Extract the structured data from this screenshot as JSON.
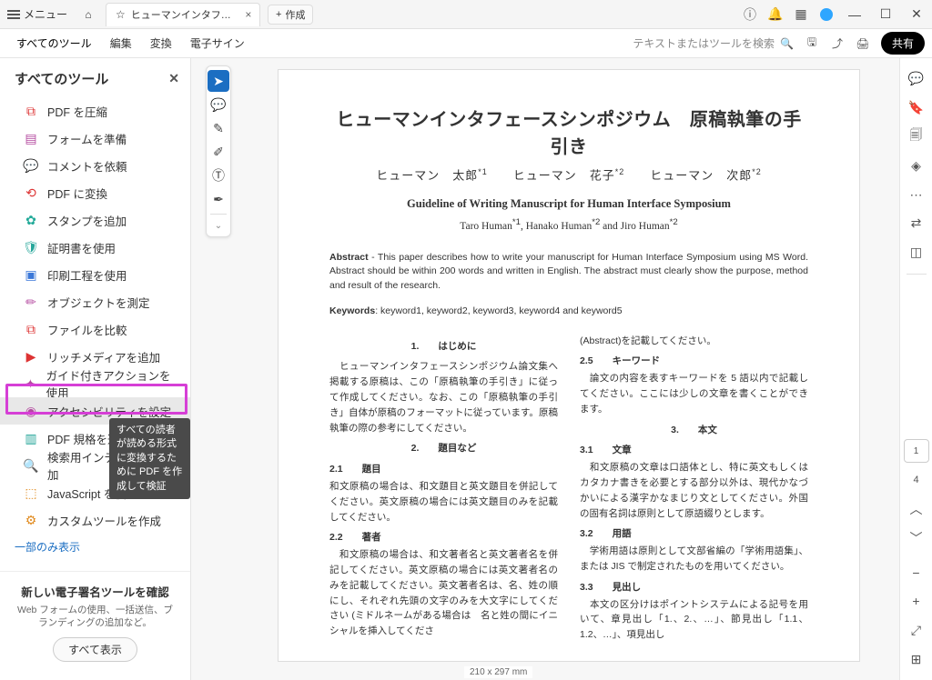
{
  "titlebar": {
    "menu": "メニュー",
    "tab_title": "ヒューマンインタフェースシ…",
    "new_tab": "作成"
  },
  "toolbar": {
    "tabs": [
      "すべてのツール",
      "編集",
      "変換",
      "電子サイン"
    ],
    "search_placeholder": "テキストまたはツールを検索",
    "share": "共有"
  },
  "sidebar": {
    "title": "すべてのツール",
    "items": [
      "PDF を圧縮",
      "フォームを準備",
      "コメントを依頼",
      "PDF に変換",
      "スタンプを追加",
      "証明書を使用",
      "印刷工程を使用",
      "オブジェクトを測定",
      "ファイルを比較",
      "リッチメディアを追加",
      "ガイド付きアクションを使用",
      "アクセシビリティを設定",
      "PDF 規格を適用",
      "検索用インデックスを追加",
      "JavaScript を使用",
      "カスタムツールを作成"
    ],
    "tooltip": "すべての読者が読める形式に変換するために PDF を作成して検証",
    "link": "一部のみ表示",
    "footer": {
      "heading": "新しい電子署名ツールを確認",
      "desc": "Web フォームの使用、一括送信、ブランディングの追加など。",
      "button": "すべて表示"
    }
  },
  "doc": {
    "title_jp": "ヒューマンインタフェースシンポジウム　原稿執筆の手引き",
    "authors_jp_html": "ヒューマン　太郎<sup>*1</sup>　　ヒューマン　花子<sup>*2</sup>　　ヒューマン　次郎<sup>*2</sup>",
    "title_en": "Guideline of Writing Manuscript for Human Interface Symposium",
    "authors_en_html": "Taro Human<sup>*1</sup>, Hanako Human<sup>*2</sup> and Jiro Human<sup>*2</sup>",
    "abstract": "Abstract - This paper describes how to write your manuscript for Human Interface Symposium using MS Word. Abstract should be within 200 words and written in English. The abstract must clearly show the purpose, method and result of the research.",
    "keywords": "Keywords: keyword1, keyword2, keyword3, keyword4 and keyword5",
    "left_col": {
      "s1_head": "1.　　はじめに",
      "s1_body": "　ヒューマンインタフェースシンポジウム論文集へ掲載する原稿は、この「原稿執筆の手引き」に従って作成してください。なお、この「原稿執筆の手引き」自体が原稿のフォーマットに従っています。原稿執筆の際の参考にしてください。",
      "s2_head": "2.　　題目など",
      "s21_head": "2.1　　題目",
      "s21_body": "和文原稿の場合は、和文題目と英文題目を併記してください。英文原稿の場合には英文題目のみを記載してください。",
      "s22_head": "2.2　　著者",
      "s22_body": "　和文原稿の場合は、和文著者名と英文著者名を併記してください。英文原稿の場合には英文著者名のみを記載してください。英文著者名は、名、姓の順にし、それぞれ先頭の文字のみを大文字にしてください (ミドルネームがある場合は　名と姓の間にイニシャルを挿入してくださ"
    },
    "right_col": {
      "abs_note": "(Abstract)を記載してください。",
      "s25_head": "2.5　　キーワード",
      "s25_body": "　論文の内容を表すキーワードを 5 語以内で記載してください。ここには少しの文章を書くことができます。",
      "s3_head": "3.　　本文",
      "s31_head": "3.1　　文章",
      "s31_body": "　和文原稿の文章は口語体とし、特に英文もしくはカタカナ書きを必要とする部分以外は、現代かなづかいによる漢字かなまじり文としてください。外国の固有名詞は原則として原語綴りとします。",
      "s32_head": "3.2　　用語",
      "s32_body": "　学術用語は原則として文部省編の「学術用語集」、または JIS で制定されたものを用いてください。",
      "s33_head": "3.3　　見出し",
      "s33_body": "　本文の区分けはポイントシステムによる記号を用いて、章見出し「1.、2.、…」、節見出し「1.1、1.2、…」、項見出し"
    },
    "page_size": "210 x 297 mm"
  },
  "right_rail": {
    "page_current": "1",
    "page_count": "4"
  }
}
